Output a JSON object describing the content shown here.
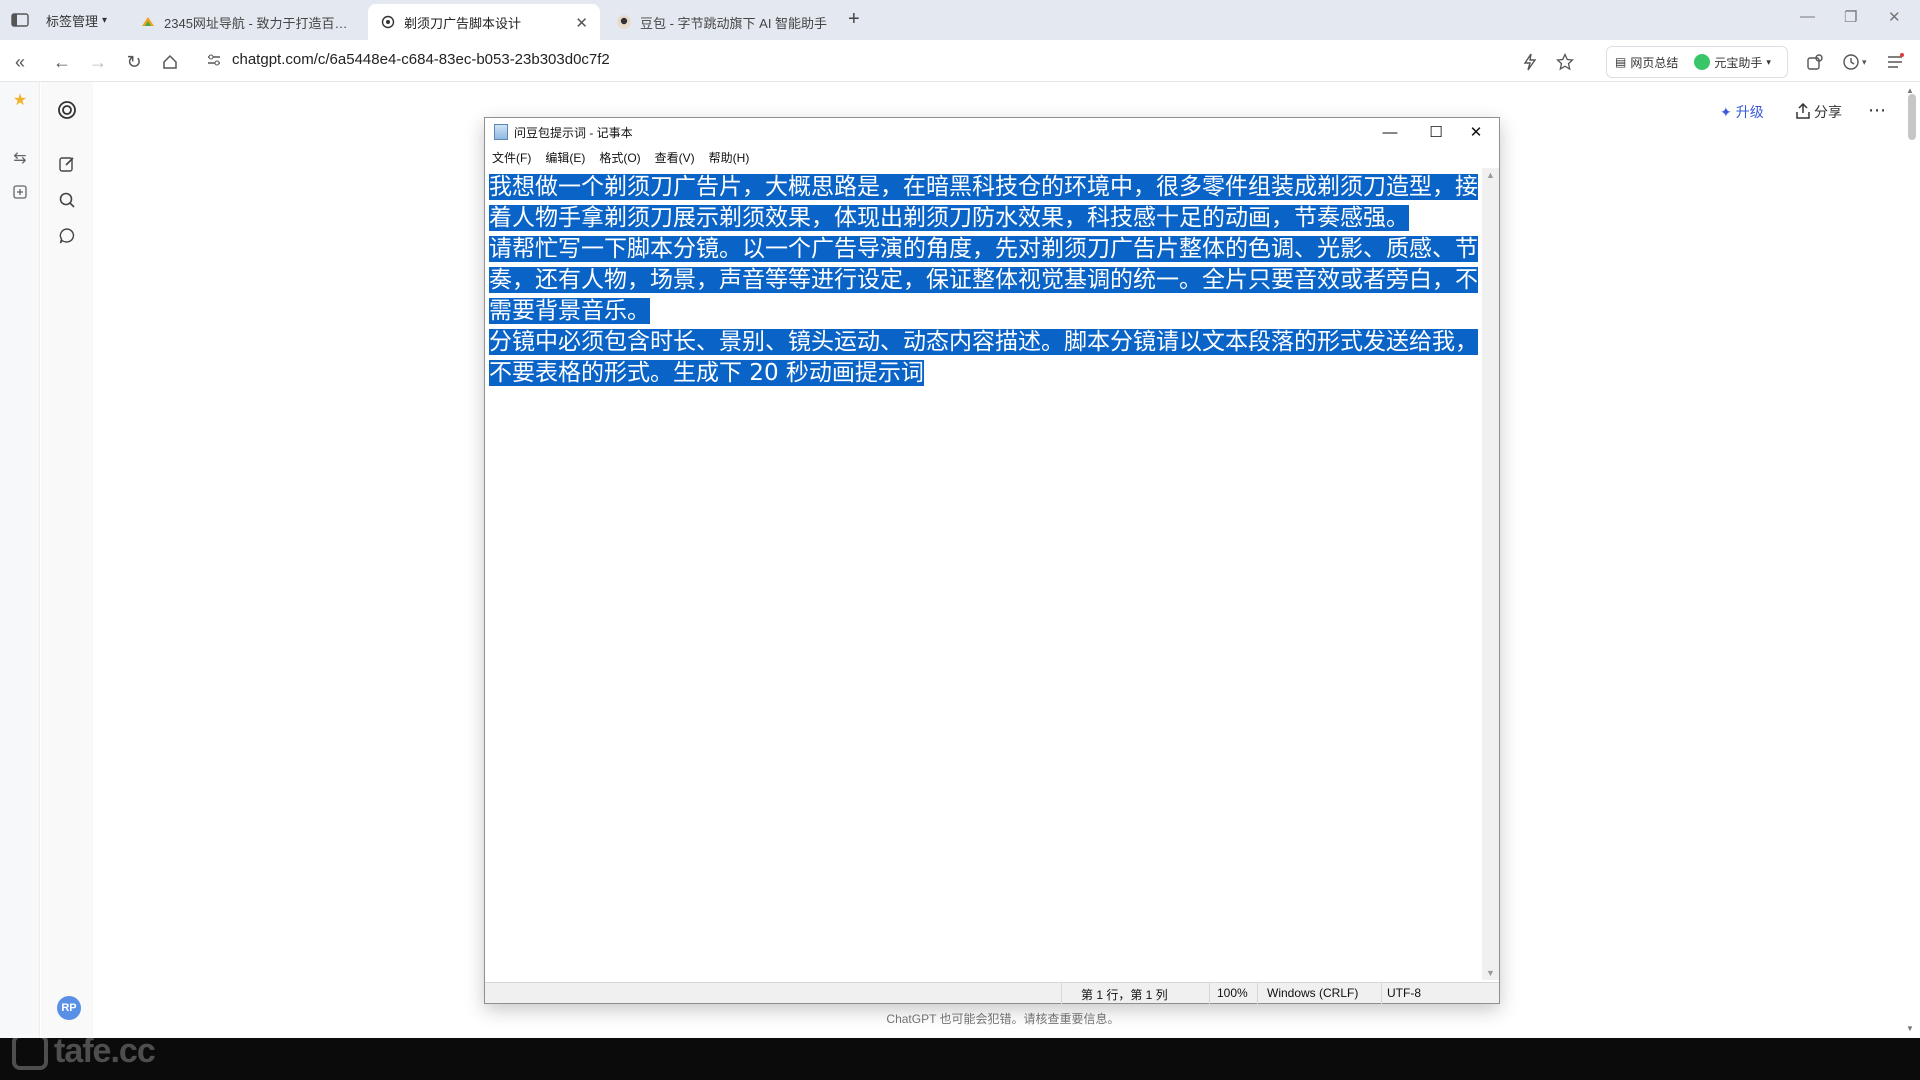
{
  "browser": {
    "tab_manager_label": "标签管理",
    "tabs": [
      {
        "title": "2345网址导航 - 致力于打造百年品牌",
        "active": false
      },
      {
        "title": "剃须刀广告脚本设计",
        "active": true
      },
      {
        "title": "豆包 - 字节跳动旗下 AI 智能助手",
        "active": false
      }
    ],
    "new_tab": "+",
    "url": "chatgpt.com/c/6a5448e4-c684-83ec-b053-23b303d0c7f2",
    "page_summary": "网页总结",
    "yuanbao": "元宝助手"
  },
  "chatgpt": {
    "upgrade": "升级",
    "share": "分享",
    "avatar": "RP",
    "disclaimer": "ChatGPT 也可能会犯错。请核查重要信息。"
  },
  "notepad": {
    "title": "问豆包提示词 - 记事本",
    "menu": [
      "文件(F)",
      "编辑(E)",
      "格式(O)",
      "查看(V)",
      "帮助(H)"
    ],
    "paragraphs": [
      "我想做一个剃须刀广告片，大概思路是，在暗黑科技仓的环境中，很多零件组装成剃须刀造型，接着人物手拿剃须刀展示剃须效果，体现出剃须刀防水效果，科技感十足的动画，节奏感强。",
      "请帮忙写一下脚本分镜。以一个广告导演的角度，先对剃须刀广告片整体的色调、光影、质感、节奏，还有人物，场景，声音等等进行设定，保证整体视觉基调的统一。全片只要音效或者旁白，不需要背景音乐。",
      "分镜中必须包含时长、景别、镜头运动、动态内容描述。脚本分镜请以文本段落的形式发送给我，不要表格的形式。生成下 20 秒动画提示词"
    ],
    "status": {
      "position": "第 1 行，第 1 列",
      "zoom": "100%",
      "line_ending": "Windows (CRLF)",
      "encoding": "UTF-8"
    }
  },
  "watermark": "tafe.cc",
  "colors": {
    "selection": "#0a64c8",
    "tabstrip": "#e4e9f1",
    "accent": "#3b5bd9"
  }
}
